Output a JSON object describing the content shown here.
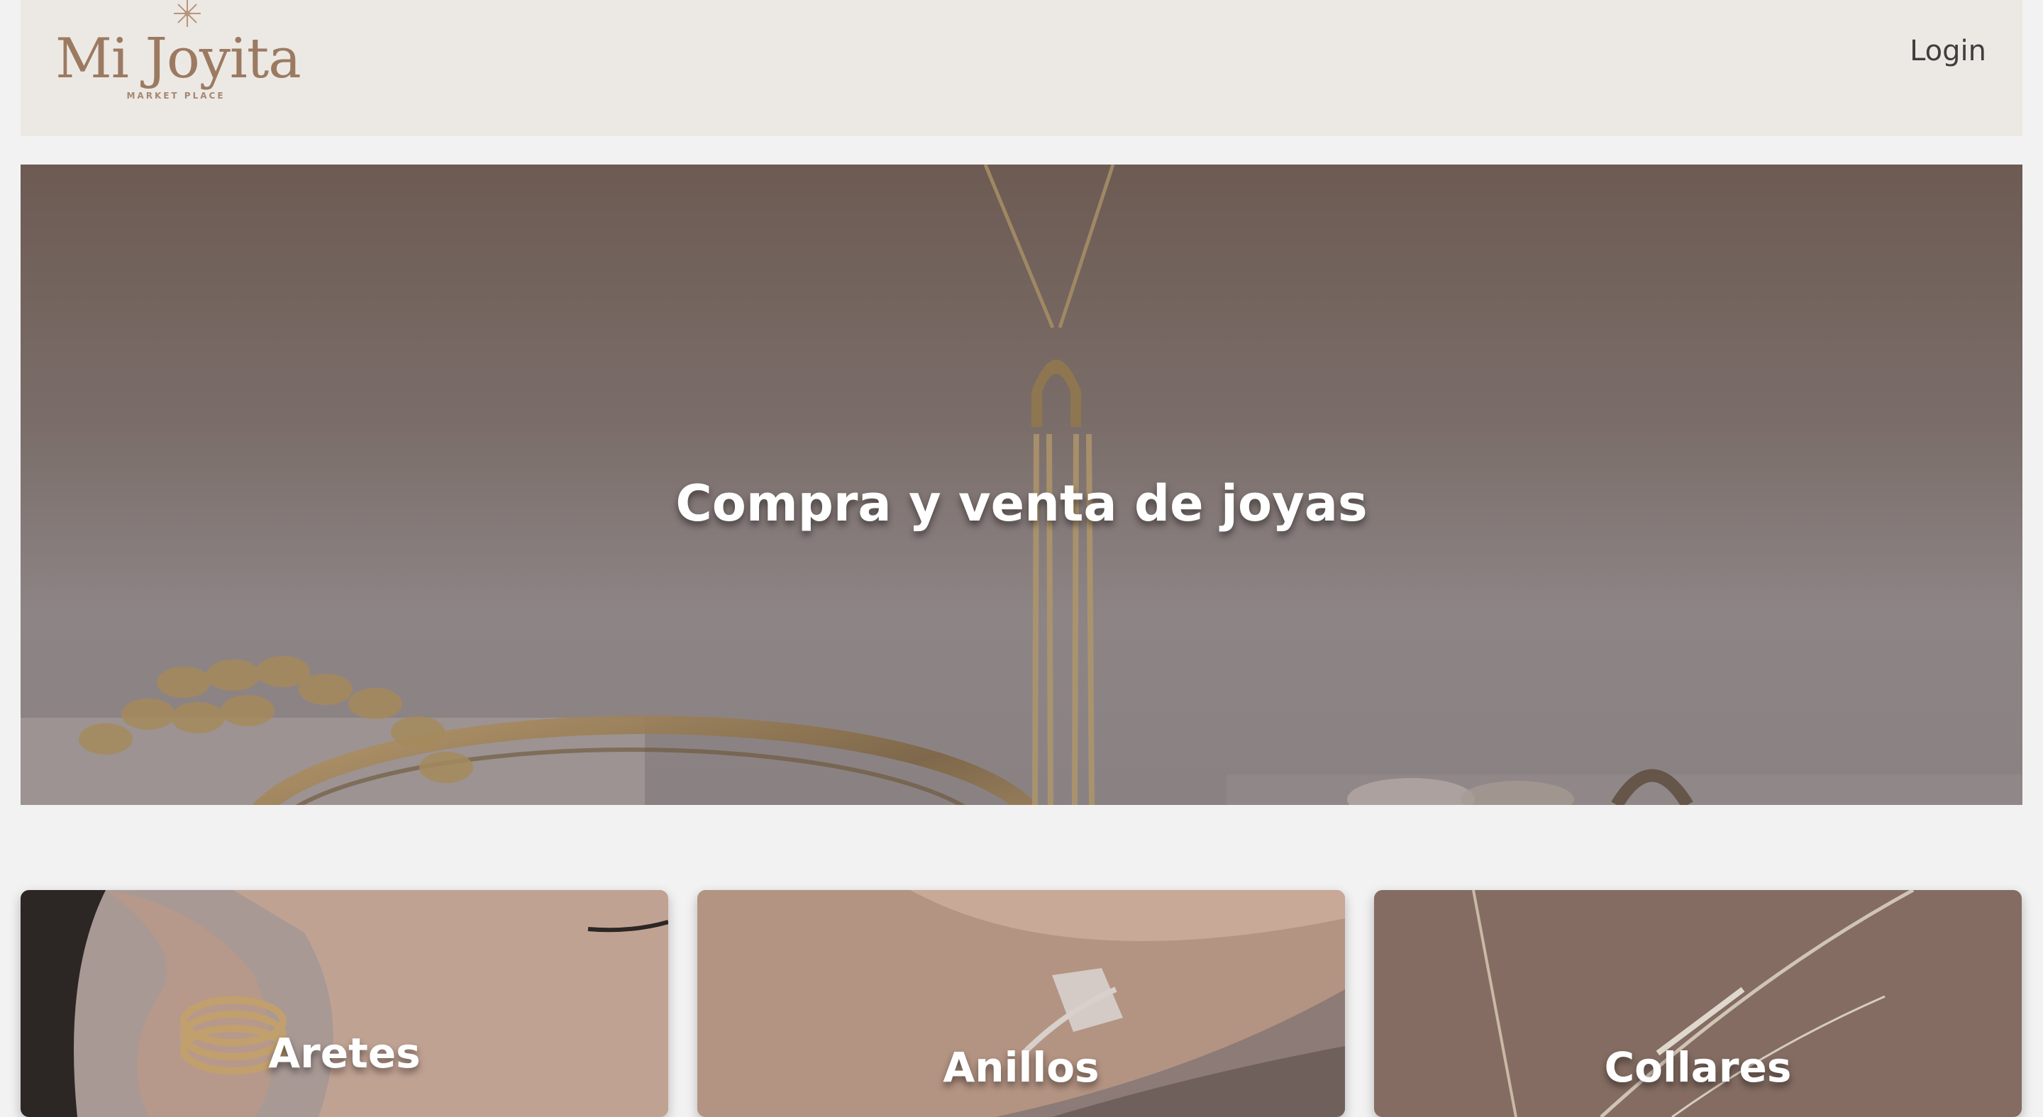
{
  "header": {
    "logo": {
      "title": "Mi Joyita",
      "subtitle": "MARKET PLACE"
    },
    "login_label": "Login"
  },
  "hero": {
    "title": "Compra y venta de joyas"
  },
  "categories": [
    {
      "label": "Aretes"
    },
    {
      "label": "Anillos"
    },
    {
      "label": "Collares"
    }
  ],
  "colors": {
    "brand": "#9c7a62",
    "header_bg": "#ece9e4",
    "page_bg": "#f3f2f2"
  }
}
